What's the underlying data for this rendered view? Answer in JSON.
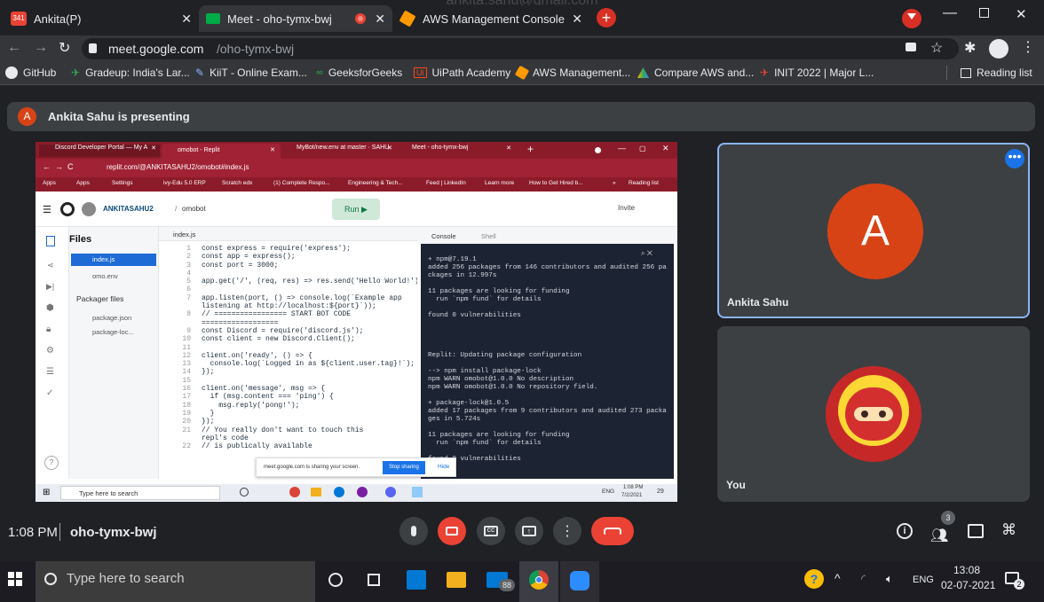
{
  "browser": {
    "tabs": [
      {
        "label": "Ankita(P)",
        "badge": "341"
      },
      {
        "label": "Meet - oho-tymx-bwj"
      },
      {
        "label": "AWS Management Console"
      }
    ],
    "url_host": "meet.google.com",
    "url_path": "/oho-tymx-bwj",
    "top_watermark": "ankita.sahu@gmail.com",
    "bookmarks": [
      "GitHub",
      "Gradeup: India's Lar...",
      "KiiT - Online Exam...",
      "GeeksforGeeks",
      "UiPath Academy",
      "AWS Management...",
      "Compare AWS and...",
      "INIT 2022 | Major L..."
    ],
    "reading_list": "Reading list"
  },
  "meet": {
    "presenter_initial": "A",
    "presenting_text": "Ankita Sahu is presenting",
    "tile1_name": "Ankita Sahu",
    "tile1_initial": "A",
    "tile2_name": "You",
    "time": "1:08 PM",
    "meeting_code": "oho-tymx-bwj",
    "people_count": "3"
  },
  "shared": {
    "tabs": [
      "Discord Developer Portal — My A",
      "omobot - Replit",
      "MyBot/new.env at master · SAHU",
      "Meet - oho-tymx-bwj"
    ],
    "url": "replit.com/@ANKITASAHU2/omobot#index.js",
    "bookmarks": [
      "Apps",
      "Apps",
      "Settings",
      "ivy-Edu 5.0 ERP",
      "Scratch edx",
      "(1) Complete Respo...",
      "Engineering & Tech...",
      "Feed | LinkedIn",
      "Learn more",
      "How to Get Hired b...",
      "»",
      "Reading list"
    ],
    "user": "ANKITASAHU2",
    "sep": "/",
    "repl": "omobot",
    "run": "Run ▶",
    "invite": "Invite",
    "files_title": "Files",
    "files": [
      "index.js",
      "omo.env"
    ],
    "packager_title": "Packager files",
    "packager_files": [
      "package.json",
      "package-loc..."
    ],
    "editor_tab": "index.js",
    "line_numbers": [
      "1",
      "2",
      "3",
      "4",
      "5",
      "6",
      "7",
      "",
      "8",
      "",
      "9",
      "10",
      "11",
      "12",
      "13",
      "14",
      "15",
      "16",
      "17",
      "18",
      "19",
      "20",
      "21",
      "",
      "22"
    ],
    "code": [
      "const express = require('express');",
      "const app = express();",
      "const port = 3000;",
      "",
      "app.get('/', (req, res) => res.send('Hello World!'));",
      "",
      "app.listen(port, () => console.log(`Example app",
      "listening at http://localhost:${port}`));",
      "// ================= START BOT CODE",
      "==================",
      "const Discord = require('discord.js');",
      "const client = new Discord.Client();",
      "",
      "client.on('ready', () => {",
      "  console.log(`Logged in as ${client.user.tag}!`);",
      "});",
      "",
      "client.on('message', msg => {",
      "  if (msg.content === 'ping') {",
      "    msg.reply('pong!');",
      "  }",
      "});",
      "// You really don't want to touch this",
      "repl's code",
      "// is publically available"
    ],
    "console_tab": "Console",
    "shell_tab": "Shell",
    "console_lines": [
      "+ npm@7.19.1",
      "added 256 packages from 146 contributors and audited 256 pa",
      "ckages in 12.997s",
      "",
      "11 packages are looking for funding",
      "  run `npm fund` for details",
      "",
      "found 0 vulnerabilities",
      "",
      "",
      "",
      "",
      "Replit: Updating package configuration",
      "",
      "--> npm install package-lock",
      "npm WARN omobot@1.0.0 No description",
      "npm WARN omobot@1.0.0 No repository field.",
      "",
      "+ package-lock@1.0.5",
      "added 17 packages from 9 contributors and audited 273 packa",
      "ges in 5.724s",
      "",
      "11 packages are looking for funding",
      "  run `npm fund` for details",
      "",
      "found 0 vulnerabilities"
    ],
    "sharing_text": "meet.google.com is sharing your screen.",
    "stop_sharing": "Stop sharing",
    "hide": "Hide",
    "taskbar_search": "Type here to search",
    "taskbar_lang": "ENG",
    "taskbar_time": "1:08 PM",
    "taskbar_date": "7/2/2021",
    "notif": "29"
  },
  "taskbar": {
    "search_placeholder": "Type here to search",
    "mail_badge": "88",
    "lang": "ENG",
    "time": "13:08",
    "date": "02-07-2021",
    "notif": "2"
  }
}
